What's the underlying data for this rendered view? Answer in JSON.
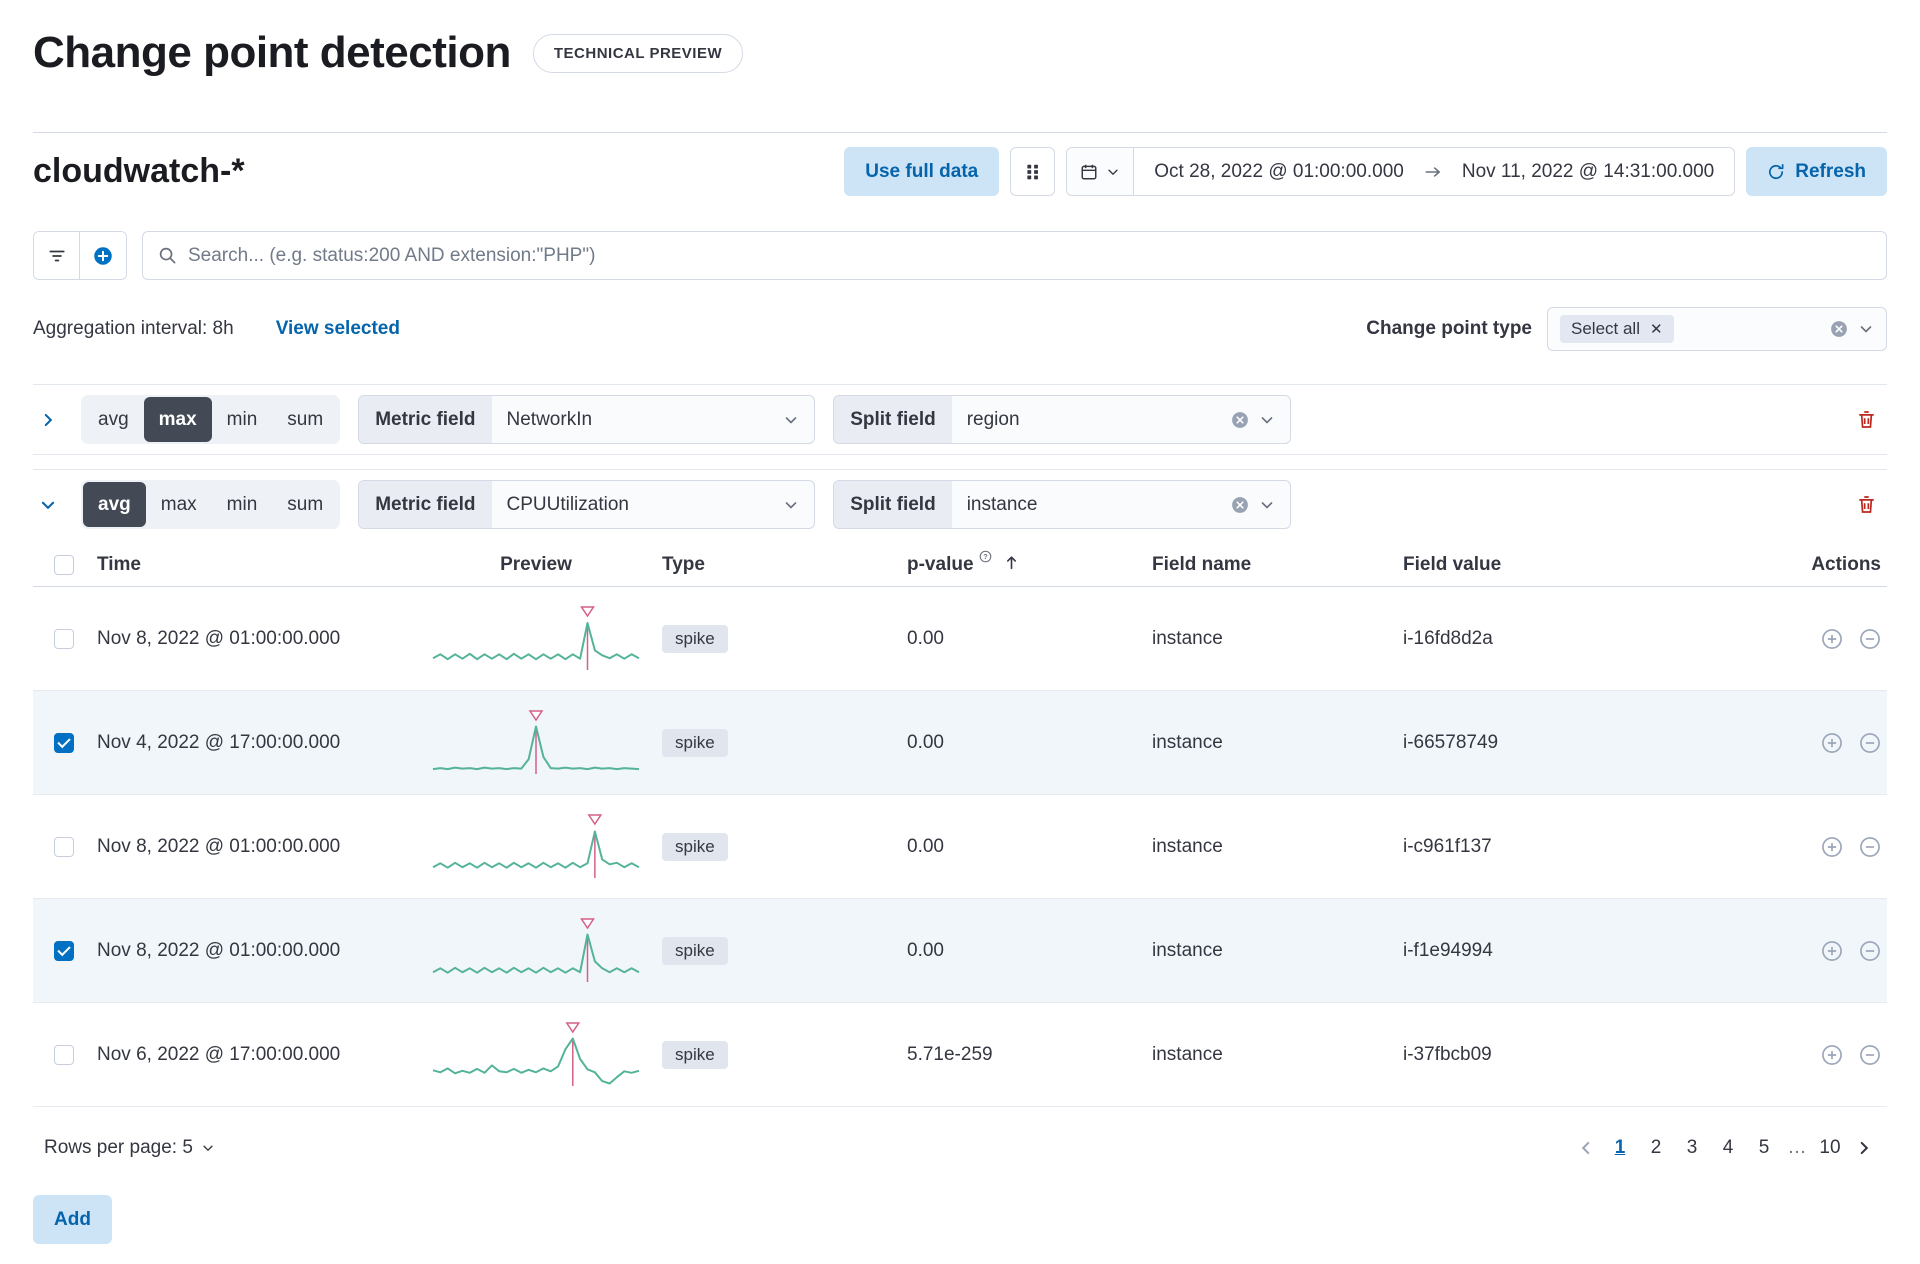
{
  "colors": {
    "accent": "#0071c2",
    "spark_line": "#54b399",
    "spark_spike": "#d36086"
  },
  "header": {
    "title": "Change point detection",
    "badge": "TECHNICAL PREVIEW"
  },
  "toolbar": {
    "index_pattern": "cloudwatch-*",
    "use_full_data_label": "Use full data",
    "date_start": "Oct 28, 2022 @ 01:00:00.000",
    "date_end": "Nov 11, 2022 @ 14:31:00.000",
    "refresh_label": "Refresh"
  },
  "search": {
    "placeholder": "Search... (e.g. status:200 AND extension:\"PHP\")"
  },
  "meta": {
    "aggregation_interval": "Aggregation interval: 8h",
    "view_selected_label": "View selected",
    "change_point_type_label": "Change point type",
    "selected_type": "Select all"
  },
  "configs": [
    {
      "expanded": false,
      "agg_options": [
        "avg",
        "max",
        "min",
        "sum"
      ],
      "selected": "max",
      "metric_label": "Metric field",
      "metric_value": "NetworkIn",
      "split_label": "Split field",
      "split_value": "region"
    },
    {
      "expanded": true,
      "agg_options": [
        "avg",
        "max",
        "min",
        "sum"
      ],
      "selected": "avg",
      "metric_label": "Metric field",
      "metric_value": "CPUUtilization",
      "split_label": "Split field",
      "split_value": "instance"
    }
  ],
  "table": {
    "headers": {
      "time": "Time",
      "preview": "Preview",
      "type": "Type",
      "p_value": "p-value",
      "field_name": "Field name",
      "field_value": "Field value",
      "actions": "Actions"
    },
    "rows": [
      {
        "checked": false,
        "time": "Nov 8, 2022 @ 01:00:00.000",
        "type": "spike",
        "p_value": "0.00",
        "field_name": "instance",
        "field_value": "i-16fd8d2a",
        "preview": {
          "spike_index": 21,
          "values": [
            0.24,
            0.32,
            0.22,
            0.32,
            0.23,
            0.33,
            0.22,
            0.32,
            0.23,
            0.32,
            0.22,
            0.33,
            0.23,
            0.32,
            0.22,
            0.32,
            0.23,
            0.32,
            0.22,
            0.32,
            0.23,
            0.96,
            0.4,
            0.3,
            0.24,
            0.32,
            0.23,
            0.32,
            0.24
          ]
        }
      },
      {
        "checked": true,
        "time": "Nov 4, 2022 @ 17:00:00.000",
        "type": "spike",
        "p_value": "0.00",
        "field_name": "instance",
        "field_value": "i-66578749",
        "preview": {
          "spike_index": 14,
          "values": [
            0.1,
            0.12,
            0.1,
            0.13,
            0.11,
            0.12,
            0.1,
            0.13,
            0.11,
            0.12,
            0.1,
            0.12,
            0.11,
            0.3,
            0.97,
            0.35,
            0.12,
            0.11,
            0.13,
            0.11,
            0.12,
            0.1,
            0.13,
            0.11,
            0.12,
            0.1,
            0.12,
            0.11,
            0.1
          ]
        }
      },
      {
        "checked": false,
        "time": "Nov 8, 2022 @ 01:00:00.000",
        "type": "spike",
        "p_value": "0.00",
        "field_name": "instance",
        "field_value": "i-c961f137",
        "preview": {
          "spike_index": 22,
          "values": [
            0.22,
            0.3,
            0.21,
            0.31,
            0.22,
            0.3,
            0.21,
            0.31,
            0.22,
            0.3,
            0.21,
            0.31,
            0.22,
            0.3,
            0.21,
            0.31,
            0.22,
            0.3,
            0.21,
            0.31,
            0.22,
            0.3,
            0.95,
            0.38,
            0.28,
            0.31,
            0.22,
            0.3,
            0.22
          ]
        }
      },
      {
        "checked": true,
        "time": "Nov 8, 2022 @ 01:00:00.000",
        "type": "spike",
        "p_value": "0.00",
        "field_name": "instance",
        "field_value": "i-f1e94994",
        "preview": {
          "spike_index": 21,
          "values": [
            0.2,
            0.28,
            0.19,
            0.29,
            0.2,
            0.28,
            0.19,
            0.29,
            0.2,
            0.28,
            0.19,
            0.29,
            0.2,
            0.28,
            0.19,
            0.29,
            0.2,
            0.28,
            0.19,
            0.28,
            0.2,
            0.97,
            0.42,
            0.28,
            0.2,
            0.28,
            0.2,
            0.28,
            0.2
          ]
        }
      },
      {
        "checked": false,
        "time": "Nov 6, 2022 @ 17:00:00.000",
        "type": "spike",
        "p_value": "5.71e-259",
        "field_name": "instance",
        "field_value": "i-37fbcb09",
        "preview": {
          "spike_index": 19,
          "values": [
            0.32,
            0.28,
            0.36,
            0.26,
            0.31,
            0.27,
            0.35,
            0.27,
            0.42,
            0.3,
            0.28,
            0.35,
            0.27,
            0.33,
            0.28,
            0.36,
            0.3,
            0.4,
            0.75,
            0.97,
            0.55,
            0.34,
            0.28,
            0.1,
            0.05,
            0.18,
            0.3,
            0.27,
            0.31
          ]
        }
      }
    ]
  },
  "footer": {
    "rows_per_page_label": "Rows per page: 5",
    "pages": [
      "1",
      "2",
      "3",
      "4",
      "5",
      "…",
      "10"
    ],
    "active_page": "1"
  },
  "add_label": "Add"
}
